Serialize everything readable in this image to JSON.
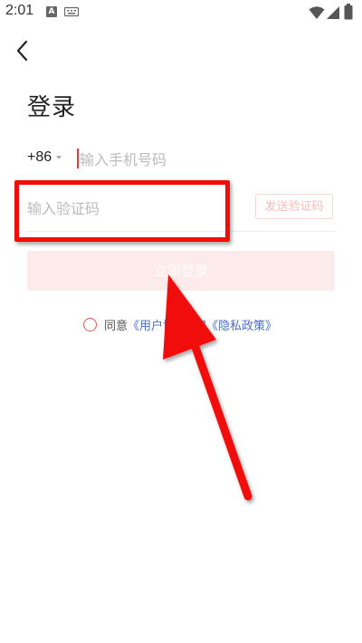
{
  "status_bar": {
    "time": "2:01",
    "icons": [
      "a-icon",
      "keyboard-icon",
      "wifi-icon",
      "signal-icon",
      "battery-icon"
    ]
  },
  "header": {
    "back_icon": "chevron-left-icon",
    "title": "登录"
  },
  "phone": {
    "country_code": "+86",
    "placeholder": "输入手机号码",
    "value": ""
  },
  "code": {
    "placeholder": "输入验证码",
    "value": "",
    "send_label": "发送验证码"
  },
  "login_button": {
    "label": "立即登录"
  },
  "agreement": {
    "prefix": "同意",
    "user_agreement": "《用户协",
    "conjunction": "和",
    "privacy_policy": "《隐私政策》"
  },
  "annotation": {
    "color": "#f20d0d"
  },
  "colors": {
    "accent": "#e25656",
    "link": "#4a6fd0",
    "disabled_button_bg": "#fdeaea"
  }
}
